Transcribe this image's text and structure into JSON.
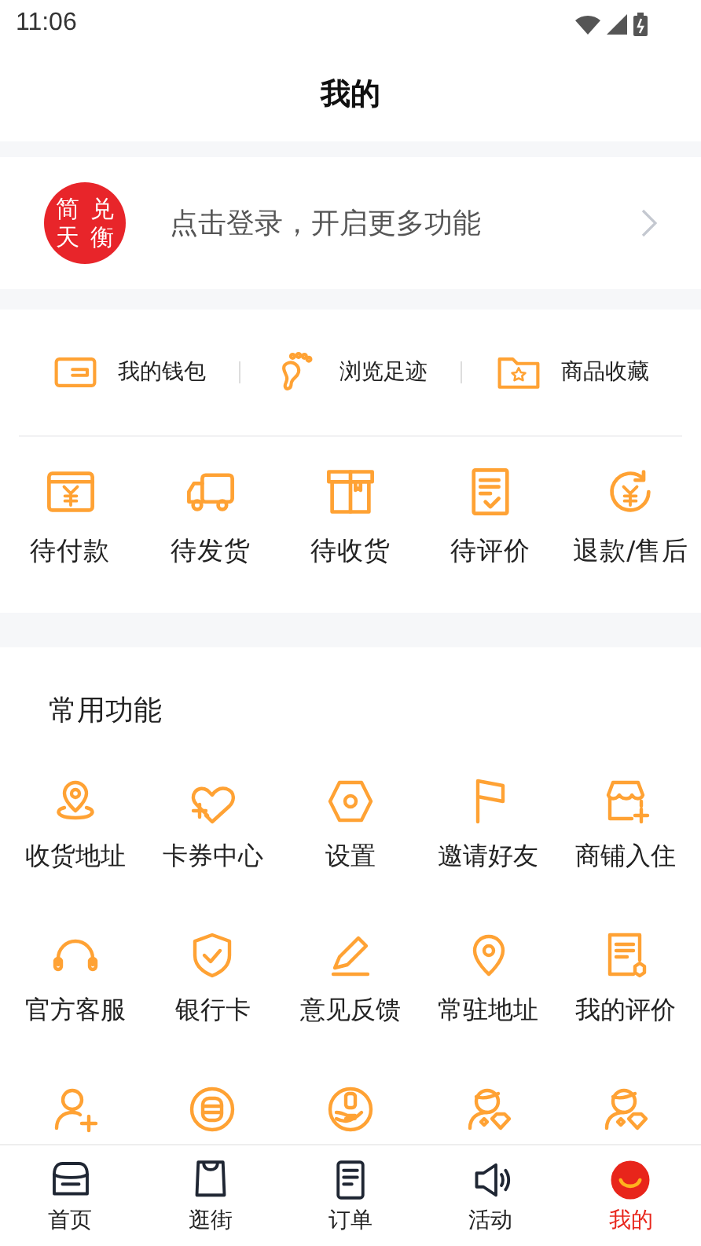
{
  "status_bar": {
    "time": "11:06"
  },
  "header": {
    "title": "我的"
  },
  "login": {
    "prompt": "点击登录，开启更多功能",
    "logo_chars": [
      "简",
      "兑",
      "天",
      "衡"
    ]
  },
  "quick_links": [
    {
      "label": "我的钱包"
    },
    {
      "label": "浏览足迹"
    },
    {
      "label": "商品收藏"
    }
  ],
  "orders": [
    {
      "label": "待付款"
    },
    {
      "label": "待发货"
    },
    {
      "label": "待收货"
    },
    {
      "label": "待评价"
    },
    {
      "label": "退款/售后"
    }
  ],
  "functions": {
    "title": "常用功能",
    "items": [
      {
        "kind": "labeled",
        "label": "收货地址"
      },
      {
        "kind": "labeled",
        "label": "卡券中心"
      },
      {
        "kind": "labeled",
        "label": "设置"
      },
      {
        "kind": "labeled",
        "label": "邀请好友"
      },
      {
        "kind": "labeled",
        "label": "商铺入住"
      },
      {
        "kind": "labeled",
        "label": "官方客服"
      },
      {
        "kind": "labeled",
        "label": "银行卡"
      },
      {
        "kind": "labeled",
        "label": "意见反馈"
      },
      {
        "kind": "labeled",
        "label": "常驻地址"
      },
      {
        "kind": "labeled",
        "label": "我的评价"
      },
      {
        "kind": "icon_only"
      },
      {
        "kind": "icon_only"
      },
      {
        "kind": "icon_only"
      },
      {
        "kind": "icon_only"
      },
      {
        "kind": "icon_only"
      }
    ]
  },
  "tab_bar": [
    {
      "label": "首页",
      "selected": false
    },
    {
      "label": "逛街",
      "selected": false
    },
    {
      "label": "订单",
      "selected": false
    },
    {
      "label": "活动",
      "selected": false
    },
    {
      "label": "我的",
      "selected": true
    }
  ]
}
